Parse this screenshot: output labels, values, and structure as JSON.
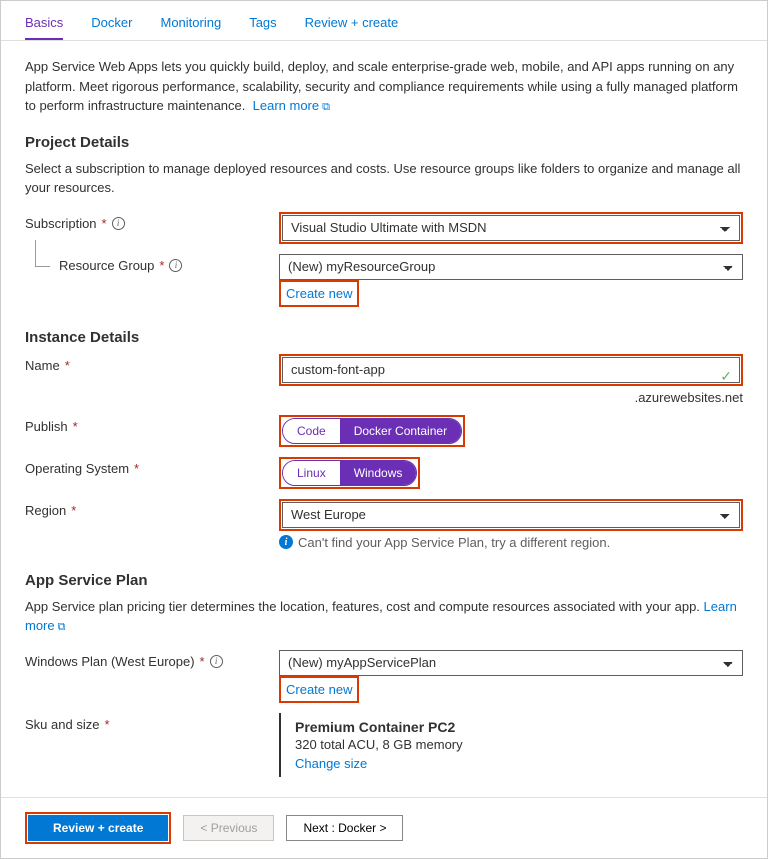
{
  "tabs": [
    "Basics",
    "Docker",
    "Monitoring",
    "Tags",
    "Review + create"
  ],
  "intro": "App Service Web Apps lets you quickly build, deploy, and scale enterprise-grade web, mobile, and API apps running on any platform. Meet rigorous performance, scalability, security and compliance requirements while using a fully managed platform to perform infrastructure maintenance.",
  "learn_more": "Learn more",
  "sections": {
    "project": {
      "title": "Project Details",
      "help": "Select a subscription to manage deployed resources and costs. Use resource groups like folders to organize and manage all your resources.",
      "subscription_label": "Subscription",
      "subscription_value": "Visual Studio Ultimate with MSDN",
      "rg_label": "Resource Group",
      "rg_value": "(New) myResourceGroup",
      "create_new": "Create new"
    },
    "instance": {
      "title": "Instance Details",
      "name_label": "Name",
      "name_value": "custom-font-app",
      "suffix": ".azurewebsites.net",
      "publish_label": "Publish",
      "publish_options": [
        "Code",
        "Docker Container"
      ],
      "os_label": "Operating System",
      "os_options": [
        "Linux",
        "Windows"
      ],
      "region_label": "Region",
      "region_value": "West Europe",
      "region_hint": "Can't find your App Service Plan, try a different region."
    },
    "plan": {
      "title": "App Service Plan",
      "help": "App Service plan pricing tier determines the location, features, cost and compute resources associated with your app.",
      "plan_label": "Windows Plan (West Europe)",
      "plan_value": "(New) myAppServicePlan",
      "create_new": "Create new",
      "sku_label": "Sku and size",
      "sku_title": "Premium Container PC2",
      "sku_sub": "320 total ACU, 8 GB memory",
      "change_size": "Change size"
    }
  },
  "footer": {
    "review": "Review + create",
    "previous": "< Previous",
    "next": "Next : Docker >"
  }
}
